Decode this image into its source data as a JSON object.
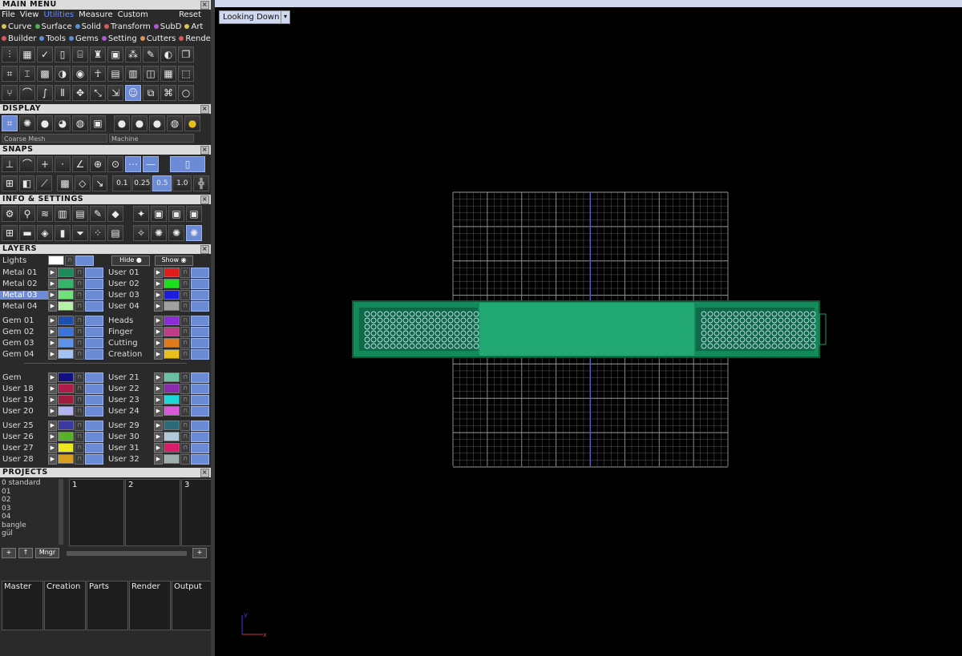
{
  "main_menu": {
    "title": "MAIN MENU",
    "menubar": [
      "File",
      "View",
      "Utilities",
      "Measure",
      "Custom"
    ],
    "reset": "Reset",
    "row1": [
      {
        "label": "Curve",
        "color": "#d9c55a"
      },
      {
        "label": "Surface",
        "color": "#4fb04f"
      },
      {
        "label": "Solid",
        "color": "#5a8fd8"
      },
      {
        "label": "Transform",
        "color": "#d85a5a"
      },
      {
        "label": "SubD",
        "color": "#b05ad8"
      },
      {
        "label": "Art",
        "color": "#d9c55a"
      }
    ],
    "row2": [
      {
        "label": "Builder",
        "color": "#d85a5a"
      },
      {
        "label": "Tools",
        "color": "#5a8fd8"
      },
      {
        "label": "Gems",
        "color": "#5a8fd8"
      },
      {
        "label": "Setting",
        "color": "#b05ad8"
      },
      {
        "label": "Cutters",
        "color": "#d8955a"
      },
      {
        "label": "Render",
        "color": "#d85a5a"
      }
    ]
  },
  "display": {
    "title": "DISPLAY",
    "mesh": "Coarse Mesh",
    "material": "Machine"
  },
  "snaps": {
    "title": "SNAPS",
    "values": [
      "0.1",
      "0.25",
      "0.5",
      "1.0"
    ]
  },
  "info": {
    "title": "INFO & SETTINGS"
  },
  "layers": {
    "title": "LAYERS",
    "lights": "Lights",
    "hide": "Hide",
    "show": "Show",
    "left_groups": [
      [
        {
          "name": "Metal 01",
          "color": "#1d8a5a"
        },
        {
          "name": "Metal 02",
          "color": "#33b56a"
        },
        {
          "name": "Metal 03",
          "color": "#6fe07a",
          "selected": true
        },
        {
          "name": "Metal 04",
          "color": "#b6f0a8"
        }
      ],
      [
        {
          "name": "Gem 01",
          "color": "#1c4fb0"
        },
        {
          "name": "Gem 02",
          "color": "#3a74d8"
        },
        {
          "name": "Gem 03",
          "color": "#5d94e8"
        },
        {
          "name": "Gem 04",
          "color": "#a5c3f2"
        }
      ],
      [
        {
          "name": "Gem",
          "color": "#101080"
        },
        {
          "name": "User 18",
          "color": "#b01c4a"
        },
        {
          "name": "User 19",
          "color": "#a01c3a"
        },
        {
          "name": "User 20",
          "color": "#b4b4f0"
        }
      ],
      [
        {
          "name": "User 25",
          "color": "#3a3aa0"
        },
        {
          "name": "User 26",
          "color": "#5ab02a"
        },
        {
          "name": "User 27",
          "color": "#e8e81c"
        },
        {
          "name": "User 28",
          "color": "#d8a01c"
        }
      ]
    ],
    "right_groups": [
      [
        {
          "name": "User 01",
          "color": "#e01c1c"
        },
        {
          "name": "User 02",
          "color": "#1ce01c"
        },
        {
          "name": "User 03",
          "color": "#1c1ce0"
        },
        {
          "name": "User 04",
          "color": "#a0a0a0"
        }
      ],
      [
        {
          "name": "Heads",
          "color": "#8a2ad8"
        },
        {
          "name": "Finger",
          "color": "#c03a8a"
        },
        {
          "name": "Cutting",
          "color": "#e07a1c"
        },
        {
          "name": "Creation",
          "color": "#e8c01c"
        }
      ],
      [
        {
          "name": "User 21",
          "color": "#6ac0a0"
        },
        {
          "name": "User 22",
          "color": "#8a2ab0"
        },
        {
          "name": "User 23",
          "color": "#1cd8d8"
        },
        {
          "name": "User 24",
          "color": "#d85ad8"
        }
      ],
      [
        {
          "name": "User 29",
          "color": "#2a6a7a"
        },
        {
          "name": "User 30",
          "color": "#b0c8d8"
        },
        {
          "name": "User 31",
          "color": "#d81c6a"
        },
        {
          "name": "User 32",
          "color": "#a0b0b0"
        }
      ]
    ]
  },
  "projects": {
    "title": "PROJECTS",
    "list": [
      "0 standard",
      "01",
      "02",
      "03",
      "04",
      "bangle",
      "gül"
    ],
    "cards": [
      "1",
      "2",
      "3"
    ],
    "mngr": "Mngr"
  },
  "bottom_tabs": [
    "Master",
    "Creation",
    "Parts",
    "Render",
    "Output"
  ],
  "viewport": {
    "view_label": "Looking Down"
  }
}
